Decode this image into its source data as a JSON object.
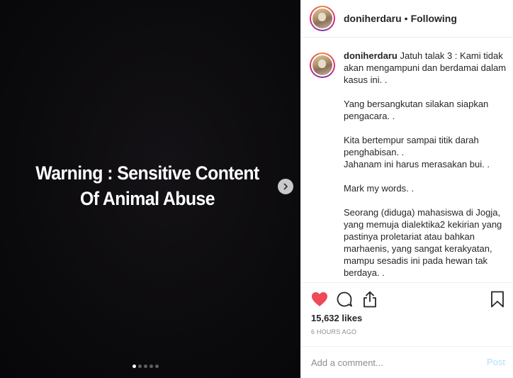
{
  "media": {
    "overlay_line1": "Warning : Sensitive Content",
    "overlay_line2": "Of Animal Abuse",
    "next_icon": "chevron-right-icon",
    "slide_count": 5,
    "active_slide": 1
  },
  "header": {
    "username": "doniherdaru",
    "separator": "•",
    "follow_status": "Following"
  },
  "caption": {
    "username": "doniherdaru",
    "text": "Jatuh talak 3 : Kami tidak akan mengampuni dan berdamai dalam kasus ini. .\n\nYang bersangkutan silakan siapkan pengacara. .\n\nKita bertempur sampai titik darah penghabisan. .\nJahanam ini harus merasakan bui. .\n\nMark my words. .\n\nSeorang (diduga) mahasiswa di Jogja, yang memuja dialektika2 kekirian yang pastinya proletariat atau bahkan marhaenis, yang sangat kerakyatan, mampu sesadis ini pada hewan tak berdaya. ."
  },
  "actions": {
    "like_icon": "heart-icon",
    "comment_icon": "comment-icon",
    "share_icon": "share-icon",
    "save_icon": "bookmark-icon",
    "liked": true,
    "like_color": "#ed4956",
    "likes_text": "15,632 likes",
    "time_text": "6 HOURS AGO"
  },
  "comment": {
    "placeholder": "Add a comment...",
    "value": "",
    "post_label": "Post",
    "post_color": "#b2dffc"
  }
}
